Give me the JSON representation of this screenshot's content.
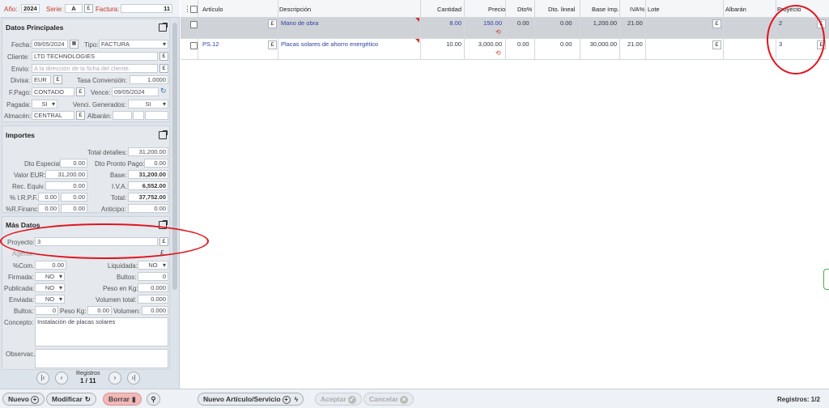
{
  "top": {
    "ano_label": "Año:",
    "ano_value": "2024",
    "serie_label": "Serie:",
    "serie_value": "A",
    "factura_label": "Factura:",
    "factura_value": "11"
  },
  "datos": {
    "title": "Datos Principales",
    "fecha_label": "Fecha:",
    "fecha_value": "09/05/2024",
    "tipo_label": "Tipo:",
    "tipo_value": "FACTURA",
    "cliente_label": "Cliente:",
    "cliente_value": "LTD TECHNOLOGIES",
    "envio_label": "Envío:",
    "envio_placeholder": "A la dirección de la ficha del cliente.",
    "divisa_label": "Divisa:",
    "divisa_value": "EUR",
    "tasa_label": "Tasa Conversión:",
    "tasa_value": "1.0000",
    "fpago_label": "F.Pago:",
    "fpago_value": "CONTADO",
    "vence_label": "Vence:",
    "vence_value": "09/05/2024",
    "pagada_label": "Pagada:",
    "pagada_value": "SI",
    "venci_label": "Venci. Generados:",
    "venci_value": "SI",
    "almacen_label": "Almacén:",
    "almacen_value": "CENTRAL",
    "albaran_label": "Albarán:"
  },
  "importes": {
    "title": "Importes",
    "total_detalles_label": "Total detalles:",
    "total_detalles": "31,200.00",
    "dto_especial_label": "Dto Especial:",
    "dto_especial": "0.00",
    "dto_pronto_label": "Dto Pronto Pago:",
    "dto_pronto": "0.00",
    "valor_eur_label": "Valor EUR:",
    "valor_eur": "31,200.00",
    "base_label": "Base:",
    "base": "31,200.00",
    "rec_equiv_label": "Rec. Equiv.:",
    "rec_equiv": "0.00",
    "iva_label": "I.V.A.:",
    "iva": "6,552.00",
    "irpf_label": "% I.R.P.F.:",
    "irpf_pct": "0.00",
    "irpf_val": "0.00",
    "total_label": "Total:",
    "total": "37,752.00",
    "rfinanc_label": "%R.Financ:",
    "rfinanc_pct": "0.00",
    "rfinanc_val": "0.00",
    "anticipo_label": "Anticipo:",
    "anticipo": "0.00"
  },
  "mas": {
    "title": "Más Datos",
    "proyecto_label": "Proyecto:",
    "proyecto_value": "3",
    "agente_label": "Agente:",
    "com_label": "%Com.:",
    "com_value": "0.00",
    "liquidada_label": "Liquidada:",
    "liquidada_value": "NO",
    "firmada_label": "Firmada:",
    "firmada_value": "NO",
    "bultos_label": "Bultos:",
    "bultos_value": "0",
    "publicada_label": "Publicada:",
    "publicada_value": "NO",
    "pesokg_label": "Peso en Kg:",
    "pesokg_value": "0.000",
    "enviada_label": "Enviada:",
    "enviada_value": "NO",
    "voltotal_label": "Volumen total:",
    "voltotal_value": "0.000",
    "bultos2_label": "Bultos:",
    "bultos2_value": "0",
    "pesokg2_label": "Peso Kg:",
    "pesokg2_value": "0.00",
    "volumen_label": "Volumen:",
    "volumen_value": "0.000",
    "concepto_label": "Concepto:",
    "concepto_value": "Instalación de placas solares",
    "observac_label": "Observac."
  },
  "pager": {
    "registros_label": "Registros",
    "registros_value": "1 / 11"
  },
  "table": {
    "headers": [
      "Artículo",
      "Descripción",
      "Cantidad",
      "Precio",
      "Dto%",
      "Dto. lineal",
      "Base Imp.",
      "IVA%",
      "Lote",
      "Albarán",
      "Proyecto"
    ],
    "rows": [
      {
        "articulo": "",
        "descripcion": "Mano de obra",
        "cantidad": "8.00",
        "precio": "150.00",
        "dto": "0.00",
        "dto_lineal": "0.00",
        "base": "1,200.00",
        "iva": "21.00",
        "lote": "",
        "albaran": "",
        "proyecto": "2"
      },
      {
        "articulo": "PS.12",
        "descripcion": "Placas solares de ahorro energético",
        "cantidad": "10.00",
        "precio": "3,000.00",
        "dto": "0.00",
        "dto_lineal": "0.00",
        "base": "30,000.00",
        "iva": "21.00",
        "lote": "",
        "albaran": "",
        "proyecto": "3"
      }
    ]
  },
  "footer": {
    "nuevo": "Nuevo",
    "modificar": "Modificar",
    "borrar": "Borrar",
    "nuevo_articulo": "Nuevo Artículo/Servicio",
    "aceptar": "Aceptar",
    "cancelar": "Cancelar",
    "registros": "Registros: 1/2"
  },
  "colors": {
    "accent_red": "#e0141e",
    "label_red": "#c0392b",
    "selected_row": "#cfd3d8"
  }
}
